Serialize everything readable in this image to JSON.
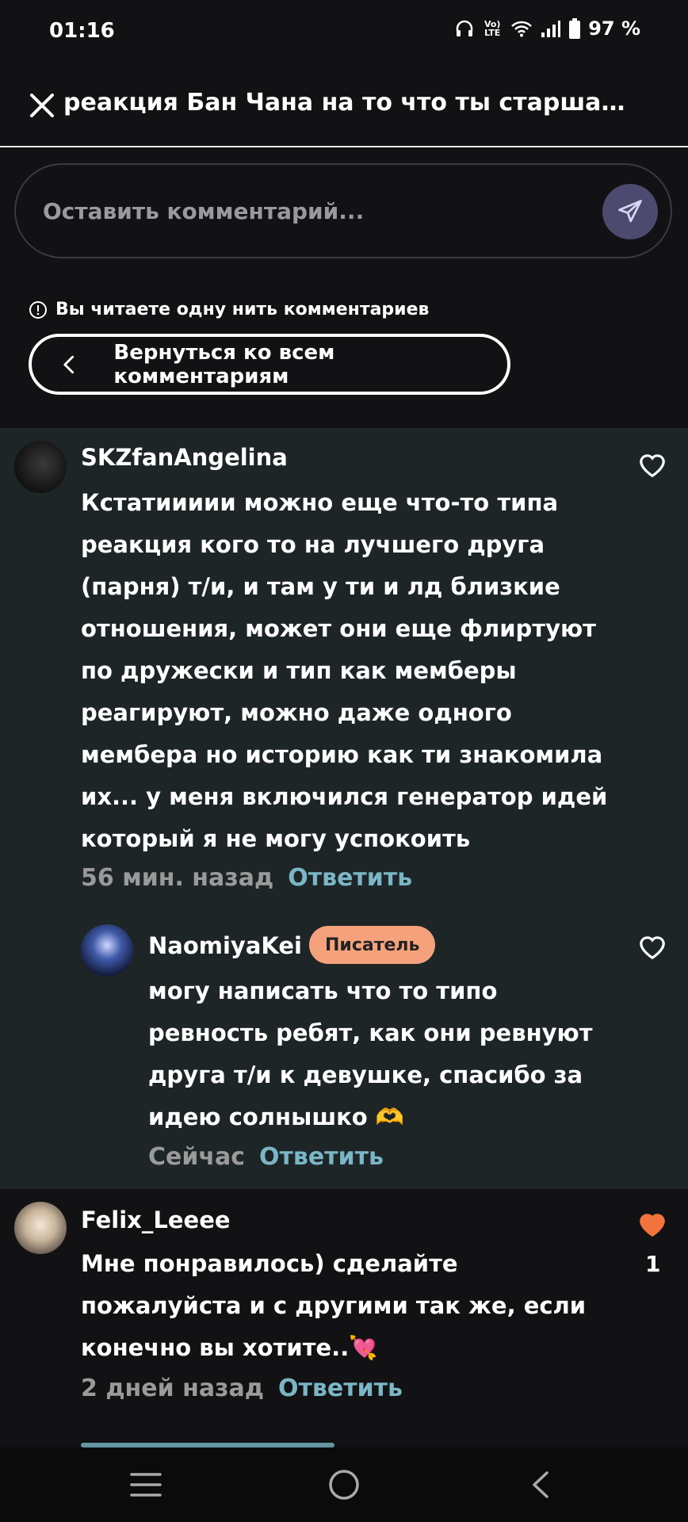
{
  "status_bar": {
    "time": "01:16",
    "network": "Vo) LTE",
    "battery": "97 %"
  },
  "header": {
    "title": "реакция Бан Чана на то что ты старшая с..."
  },
  "comment_input": {
    "placeholder": "Оставить комментарий..."
  },
  "thread_notice": {
    "text": "Вы читаете одну нить комментариев",
    "back_button": "Вернуться ко всем комментариям"
  },
  "comments": [
    {
      "user": "SKZfanAngelina",
      "text": "Кстатиииии можно еще что-то типа\nреакция кого то на лучшего друга\n(парня) т/и, и там у ти и лд близкие\nотношения, может они еще флиртуют\nпо дружески и тип как мемберы\nреагируют, можно даже одного\nмембера но историю как ти знакомила\nих... у меня включился генератор идей\nкоторый я не могу успокоить",
      "time": "56 мин. назад",
      "reply": "Ответить",
      "liked": false
    },
    {
      "user": "NaomiyaKei",
      "badge": "Писатель",
      "text": "могу написать что то типо\nревность ребят, как они ревнуют\nдруга т/и к девушке, спасибо за\nидею солнышко 🫶",
      "time": "Сейчас",
      "reply": "Ответить",
      "liked": false
    },
    {
      "user": "Felix_Leeee",
      "text": "Мне понравилось) сделайте\nпожалуйста и с другими так же, если\nконечно вы хотите..💘",
      "time": "2 дней назад",
      "reply": "Ответить",
      "liked": true,
      "likes": "1"
    }
  ],
  "colors": {
    "background": "#121214",
    "thread_background": "#1e2527",
    "reply_link": "#7ab6c6",
    "badge": "#f5a27c",
    "heart_active": "#f2743c",
    "send_button": "#4c4a6e"
  }
}
